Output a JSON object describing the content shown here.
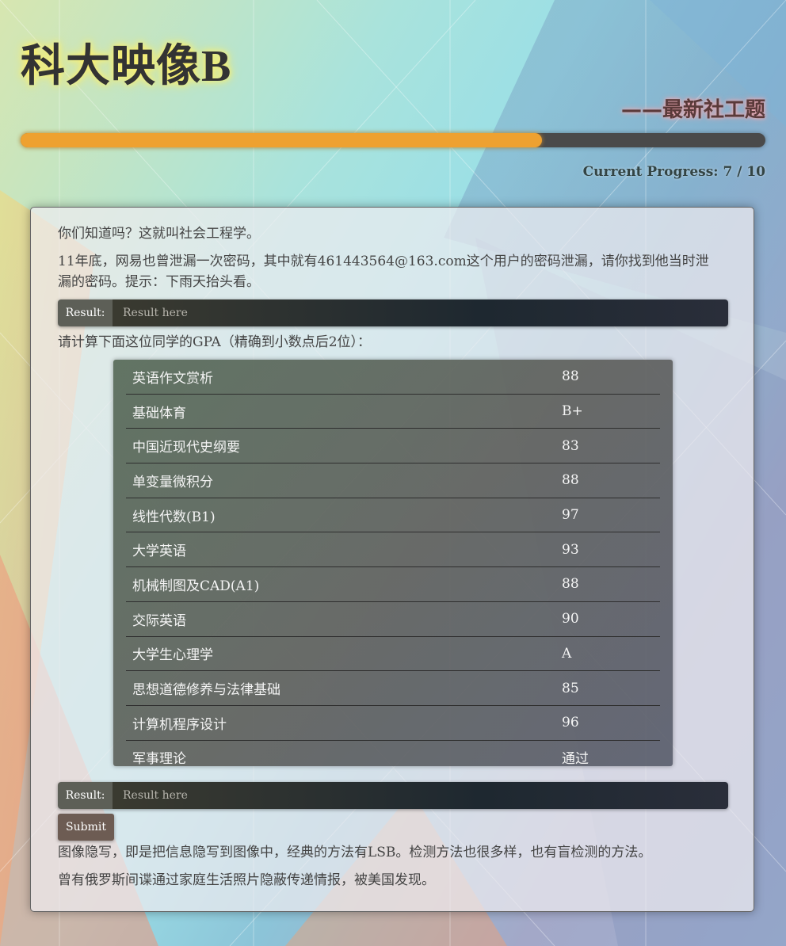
{
  "header": {
    "title": "科大映像B",
    "subtitle": "——最新社工题"
  },
  "progress": {
    "text": "Current Progress: 7 / 10",
    "current": 7,
    "total": 10,
    "fill_fraction": 0.7
  },
  "panel": {
    "intro": "你们知道吗？这就叫社会工程学。",
    "question1": "11年底，网易也曾泄漏一次密码，其中就有461443564@163.com这个用户的密码泄漏，请你找到他当时泄漏的密码。提示：下雨天抬头看。",
    "result1": {
      "label": "Result:",
      "placeholder": "Result here"
    },
    "question2": "请计算下面这位同学的GPA（精确到小数点后2位）：",
    "grades": [
      {
        "course": "英语作文赏析",
        "score": "88"
      },
      {
        "course": "基础体育",
        "score": "B+"
      },
      {
        "course": "中国近现代史纲要",
        "score": "83"
      },
      {
        "course": "单变量微积分",
        "score": "88"
      },
      {
        "course": "线性代数(B1)",
        "score": "97"
      },
      {
        "course": "大学英语",
        "score": "93"
      },
      {
        "course": "机械制图及CAD(A1)",
        "score": "88"
      },
      {
        "course": "交际英语",
        "score": "90"
      },
      {
        "course": "大学生心理学",
        "score": "A"
      },
      {
        "course": "思想道德修养与法律基础",
        "score": "85"
      },
      {
        "course": "计算机程序设计",
        "score": "96"
      },
      {
        "course": "军事理论",
        "score": "通过"
      }
    ],
    "result2": {
      "label": "Result:",
      "placeholder": "Result here"
    },
    "submit_label": "Submit",
    "footer1": "图像隐写，即是把信息隐写到图像中，经典的方法有LSB。检测方法也很多样，也有盲检测的方法。",
    "footer2": "曾有俄罗斯间谍通过家庭生活照片隐蔽传递情报，被美国发现。"
  },
  "colors": {
    "progress_fill": "#eea130",
    "progress_track": "#4a4a4a",
    "title_glow": "#fff36a",
    "subtitle_glow": "#e9a0a8",
    "submit_bg": "#6d5c53"
  }
}
